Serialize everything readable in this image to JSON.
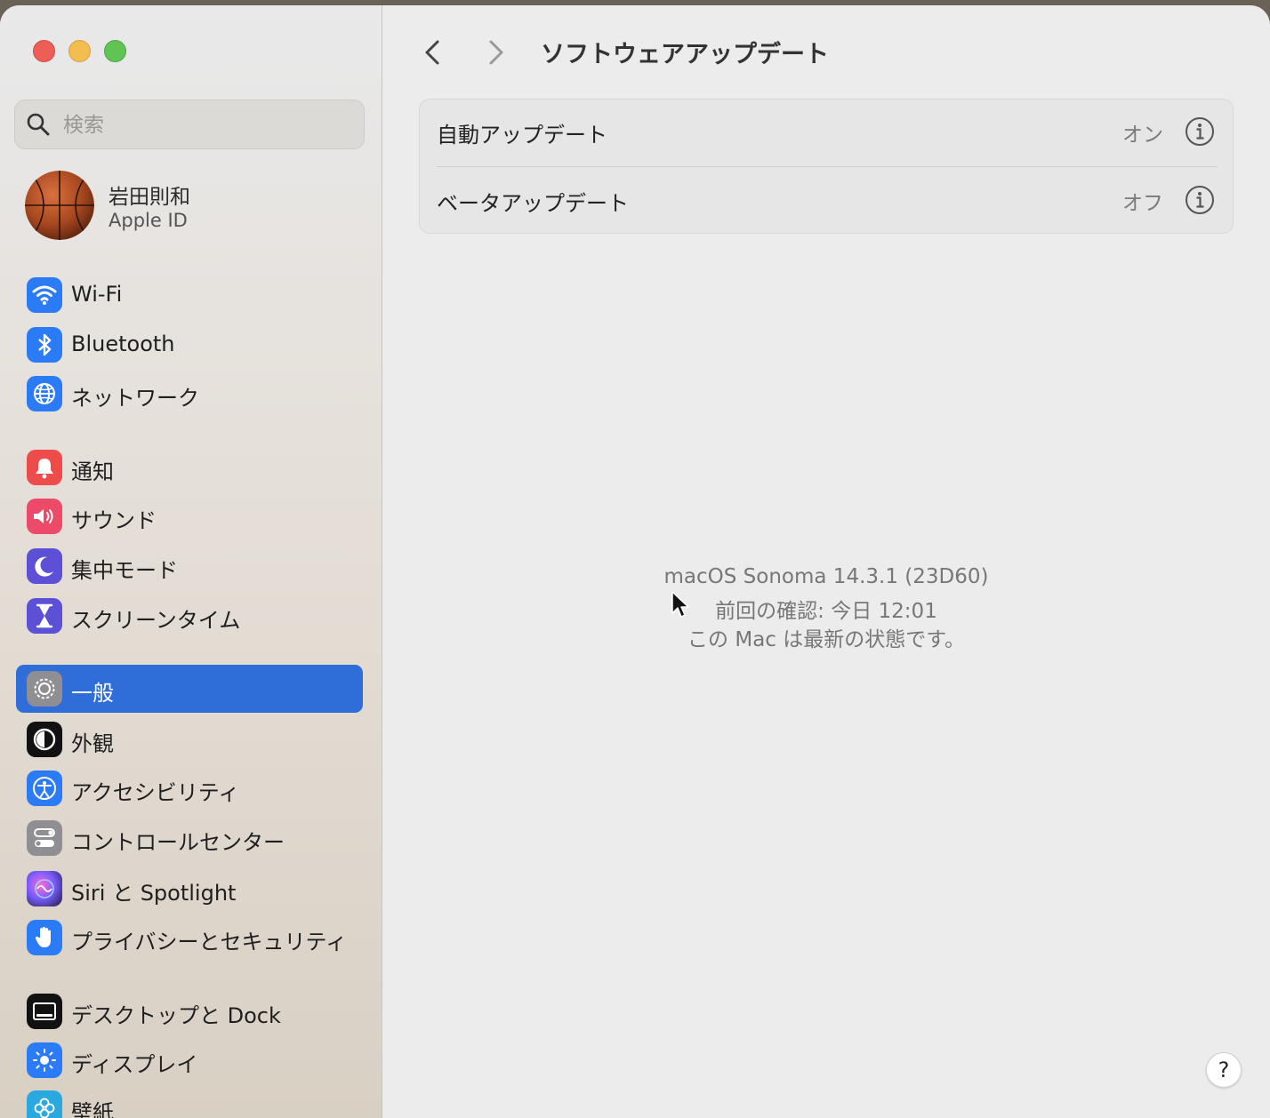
{
  "sidebar": {
    "search_placeholder": "検索",
    "profile": {
      "name": "岩田則和",
      "subtitle": "Apple ID"
    },
    "items": [
      {
        "label": "Wi-Fi",
        "icon": "wifi-icon",
        "color": "#2b7bf6"
      },
      {
        "label": "Bluetooth",
        "icon": "bluetooth-icon",
        "color": "#2b7bf6"
      },
      {
        "label": "ネットワーク",
        "icon": "globe-icon",
        "color": "#2b7bf6"
      },
      {
        "label": "通知",
        "icon": "bell-icon",
        "color": "#ee4b4b"
      },
      {
        "label": "サウンド",
        "icon": "speaker-icon",
        "color": "#ec4a68"
      },
      {
        "label": "集中モード",
        "icon": "moon-icon",
        "color": "#5c50d6"
      },
      {
        "label": "スクリーンタイム",
        "icon": "hourglass-icon",
        "color": "#5c50d6"
      },
      {
        "label": "一般",
        "icon": "gear-icon",
        "color": "#8e8e93",
        "selected": true
      },
      {
        "label": "外観",
        "icon": "appearance-icon",
        "color": "#111111"
      },
      {
        "label": "アクセシビリティ",
        "icon": "accessibility-icon",
        "color": "#2b7bf6"
      },
      {
        "label": "コントロールセンター",
        "icon": "toggles-icon",
        "color": "#8e8e93"
      },
      {
        "label": "Siri と Spotlight",
        "icon": "siri-icon",
        "color": "#3a2a6a"
      },
      {
        "label": "プライバシーとセキュリティ",
        "icon": "hand-icon",
        "color": "#2b7bf6"
      },
      {
        "label": "デスクトップと Dock",
        "icon": "dock-icon",
        "color": "#111111"
      },
      {
        "label": "ディスプレイ",
        "icon": "sun-icon",
        "color": "#2b7bf6"
      },
      {
        "label": "壁紙",
        "icon": "flower-icon",
        "color": "#2aa8e0"
      }
    ]
  },
  "content": {
    "title": "ソフトウェアアップデート",
    "rows": [
      {
        "label": "自動アップデート",
        "value": "オン"
      },
      {
        "label": "ベータアップデート",
        "value": "オフ"
      }
    ],
    "status": {
      "version": "macOS Sonoma 14.3.1 (23D60)",
      "last_checked": "前回の確認: 今日 12:01",
      "message": "この Mac は最新の状態です。"
    },
    "help_label": "?"
  }
}
